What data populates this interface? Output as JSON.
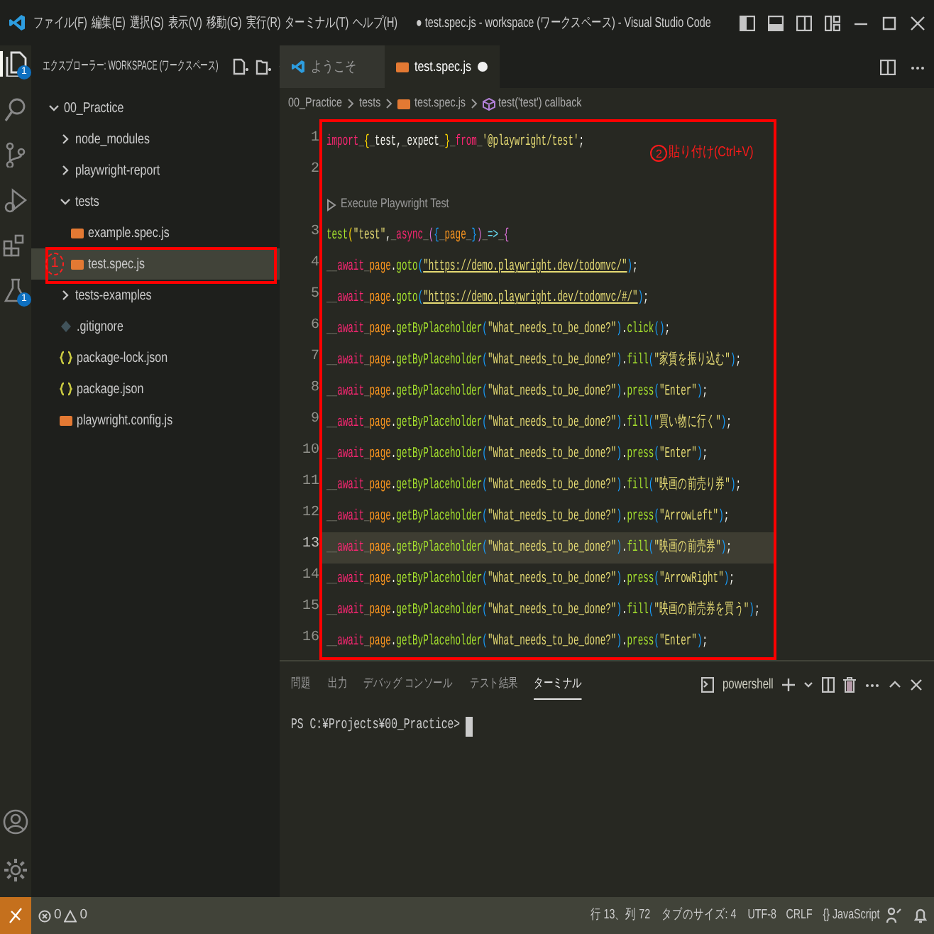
{
  "title_bar": {
    "menus": [
      "ファイル(F)",
      "編集(E)",
      "選択(S)",
      "表示(V)",
      "移動(G)",
      "実行(R)",
      "ターミナル(T)",
      "ヘルプ(H)"
    ],
    "title": "● test.spec.js - workspace (ワークスペース) - Visual Studio Code"
  },
  "activity_bar": {
    "items": [
      {
        "kind": "explorer",
        "selected": true,
        "badge": "1"
      },
      {
        "kind": "search",
        "selected": false
      },
      {
        "kind": "source-control",
        "selected": false
      },
      {
        "kind": "run-debug",
        "selected": false
      },
      {
        "kind": "extensions",
        "selected": false
      },
      {
        "kind": "testing",
        "selected": false,
        "badge": "1"
      }
    ],
    "bottom": [
      {
        "kind": "account"
      },
      {
        "kind": "settings"
      }
    ]
  },
  "sidebar": {
    "title": "エクスプローラー: WORKSPACE (ワークスペース)",
    "tree": [
      {
        "label": "00_Practice",
        "kind": "folder",
        "expanded": true,
        "selected": false,
        "children": [
          {
            "label": "node_modules",
            "kind": "folder",
            "expanded": false,
            "selected": false
          },
          {
            "label": "playwright-report",
            "kind": "folder",
            "expanded": false,
            "selected": false
          },
          {
            "label": "tests",
            "kind": "folder",
            "expanded": true,
            "selected": false,
            "children": [
              {
                "label": "example.spec.js",
                "kind": "js",
                "selected": false
              },
              {
                "label": "test.spec.js",
                "kind": "js",
                "selected": true,
                "callout": "1"
              }
            ]
          },
          {
            "label": "tests-examples",
            "kind": "folder",
            "expanded": false,
            "selected": false
          },
          {
            "label": ".gitignore",
            "kind": "gitignore",
            "selected": false
          },
          {
            "label": "package-lock.json",
            "kind": "json",
            "selected": false
          },
          {
            "label": "package.json",
            "kind": "json",
            "selected": false
          },
          {
            "label": "playwright.config.js",
            "kind": "js",
            "selected": false
          }
        ]
      }
    ]
  },
  "editor": {
    "tabs": [
      {
        "label": "ようこそ",
        "kind": "welcome",
        "selected": false,
        "modified": false
      },
      {
        "label": "test.spec.js",
        "kind": "js",
        "selected": true,
        "modified": true
      }
    ],
    "breadcrumb": [
      {
        "label": "00_Practice",
        "kind": "folder"
      },
      {
        "label": "tests",
        "kind": "folder"
      },
      {
        "label": "test.spec.js",
        "kind": "js"
      },
      {
        "label": "test('test') callback",
        "kind": "symbol"
      }
    ],
    "callout": {
      "marker": "2",
      "text": "貼り付け(Ctrl+V)"
    },
    "lines": [
      {
        "kind": "code",
        "number": "1",
        "current": false,
        "tokens": [
          {
            "kind": "keyword",
            "text": "import"
          },
          {
            "kind": "space",
            "text": "_"
          },
          {
            "kind": "bracket1",
            "text": "{"
          },
          {
            "kind": "space",
            "text": "_"
          },
          {
            "kind": "name",
            "text": "test"
          },
          {
            "kind": "punct",
            "text": ","
          },
          {
            "kind": "space",
            "text": "_"
          },
          {
            "kind": "name",
            "text": "expect"
          },
          {
            "kind": "space",
            "text": "_"
          },
          {
            "kind": "bracket1",
            "text": "}"
          },
          {
            "kind": "space",
            "text": "_"
          },
          {
            "kind": "keyword",
            "text": "from"
          },
          {
            "kind": "space",
            "text": "_"
          },
          {
            "kind": "string",
            "text": "'@playwright/test'"
          },
          {
            "kind": "punct",
            "text": ";"
          }
        ]
      },
      {
        "kind": "code",
        "number": "2",
        "current": false
      },
      {
        "kind": "codelens",
        "text": "Execute Playwright Test"
      },
      {
        "kind": "code",
        "number": "3",
        "current": false,
        "tokens": [
          {
            "kind": "function",
            "text": "test"
          },
          {
            "kind": "bracket1",
            "text": "("
          },
          {
            "kind": "string",
            "text": "\"test\""
          },
          {
            "kind": "punct",
            "text": ","
          },
          {
            "kind": "space",
            "text": "_"
          },
          {
            "kind": "keyword",
            "text": "async"
          },
          {
            "kind": "space",
            "text": "_"
          },
          {
            "kind": "bracket2",
            "text": "("
          },
          {
            "kind": "bracket3",
            "text": "{"
          },
          {
            "kind": "space",
            "text": "_"
          },
          {
            "kind": "param",
            "text": "page"
          },
          {
            "kind": "space",
            "text": "_"
          },
          {
            "kind": "bracket3",
            "text": "}"
          },
          {
            "kind": "bracket2",
            "text": ")"
          },
          {
            "kind": "space",
            "text": "_"
          },
          {
            "kind": "arrow",
            "text": "=>"
          },
          {
            "kind": "space",
            "text": "_"
          },
          {
            "kind": "bracket2",
            "text": "{"
          }
        ]
      },
      {
        "kind": "code",
        "number": "4",
        "current": false,
        "tokens": [
          {
            "kind": "space",
            "text": "__"
          },
          {
            "kind": "keyword",
            "text": "await"
          },
          {
            "kind": "space",
            "text": "_"
          },
          {
            "kind": "param",
            "text": "page"
          },
          {
            "kind": "punct",
            "text": "."
          },
          {
            "kind": "function",
            "text": "goto"
          },
          {
            "kind": "bracket3",
            "text": "("
          },
          {
            "kind": "link",
            "text": "\"https://demo.playwright.dev/todomvc/\""
          },
          {
            "kind": "bracket3",
            "text": ")"
          },
          {
            "kind": "punct",
            "text": ";"
          }
        ]
      },
      {
        "kind": "code",
        "number": "5",
        "current": false,
        "tokens": [
          {
            "kind": "space",
            "text": "__"
          },
          {
            "kind": "keyword",
            "text": "await"
          },
          {
            "kind": "space",
            "text": "_"
          },
          {
            "kind": "param",
            "text": "page"
          },
          {
            "kind": "punct",
            "text": "."
          },
          {
            "kind": "function",
            "text": "goto"
          },
          {
            "kind": "bracket3",
            "text": "("
          },
          {
            "kind": "link",
            "text": "\"https://demo.playwright.dev/todomvc/#/\""
          },
          {
            "kind": "bracket3",
            "text": ")"
          },
          {
            "kind": "punct",
            "text": ";"
          }
        ]
      },
      {
        "kind": "code",
        "number": "6",
        "current": false,
        "tokens": [
          {
            "kind": "space",
            "text": "__"
          },
          {
            "kind": "keyword",
            "text": "await"
          },
          {
            "kind": "space",
            "text": "_"
          },
          {
            "kind": "param",
            "text": "page"
          },
          {
            "kind": "punct",
            "text": "."
          },
          {
            "kind": "function",
            "text": "getByPlaceholder"
          },
          {
            "kind": "bracket3",
            "text": "("
          },
          {
            "kind": "string",
            "text": "\"What_needs_to_be_done?\""
          },
          {
            "kind": "bracket3",
            "text": ")"
          },
          {
            "kind": "punct",
            "text": "."
          },
          {
            "kind": "function",
            "text": "click"
          },
          {
            "kind": "bracket3",
            "text": "()"
          },
          {
            "kind": "punct",
            "text": ";"
          }
        ]
      },
      {
        "kind": "code",
        "number": "7",
        "current": false,
        "tokens": [
          {
            "kind": "space",
            "text": "__"
          },
          {
            "kind": "keyword",
            "text": "await"
          },
          {
            "kind": "space",
            "text": "_"
          },
          {
            "kind": "param",
            "text": "page"
          },
          {
            "kind": "punct",
            "text": "."
          },
          {
            "kind": "function",
            "text": "getByPlaceholder"
          },
          {
            "kind": "bracket3",
            "text": "("
          },
          {
            "kind": "string",
            "text": "\"What_needs_to_be_done?\""
          },
          {
            "kind": "bracket3",
            "text": ")"
          },
          {
            "kind": "punct",
            "text": "."
          },
          {
            "kind": "function",
            "text": "fill"
          },
          {
            "kind": "bracket3",
            "text": "("
          },
          {
            "kind": "string",
            "text": "\"家賃を振り込む\""
          },
          {
            "kind": "bracket3",
            "text": ")"
          },
          {
            "kind": "punct",
            "text": ";"
          }
        ]
      },
      {
        "kind": "code",
        "number": "8",
        "current": false,
        "tokens": [
          {
            "kind": "space",
            "text": "__"
          },
          {
            "kind": "keyword",
            "text": "await"
          },
          {
            "kind": "space",
            "text": "_"
          },
          {
            "kind": "param",
            "text": "page"
          },
          {
            "kind": "punct",
            "text": "."
          },
          {
            "kind": "function",
            "text": "getByPlaceholder"
          },
          {
            "kind": "bracket3",
            "text": "("
          },
          {
            "kind": "string",
            "text": "\"What_needs_to_be_done?\""
          },
          {
            "kind": "bracket3",
            "text": ")"
          },
          {
            "kind": "punct",
            "text": "."
          },
          {
            "kind": "function",
            "text": "press"
          },
          {
            "kind": "bracket3",
            "text": "("
          },
          {
            "kind": "string",
            "text": "\"Enter\""
          },
          {
            "kind": "bracket3",
            "text": ")"
          },
          {
            "kind": "punct",
            "text": ";"
          }
        ]
      },
      {
        "kind": "code",
        "number": "9",
        "current": false,
        "tokens": [
          {
            "kind": "space",
            "text": "__"
          },
          {
            "kind": "keyword",
            "text": "await"
          },
          {
            "kind": "space",
            "text": "_"
          },
          {
            "kind": "param",
            "text": "page"
          },
          {
            "kind": "punct",
            "text": "."
          },
          {
            "kind": "function",
            "text": "getByPlaceholder"
          },
          {
            "kind": "bracket3",
            "text": "("
          },
          {
            "kind": "string",
            "text": "\"What_needs_to_be_done?\""
          },
          {
            "kind": "bracket3",
            "text": ")"
          },
          {
            "kind": "punct",
            "text": "."
          },
          {
            "kind": "function",
            "text": "fill"
          },
          {
            "kind": "bracket3",
            "text": "("
          },
          {
            "kind": "string",
            "text": "\"買い物に行く\""
          },
          {
            "kind": "bracket3",
            "text": ")"
          },
          {
            "kind": "punct",
            "text": ";"
          }
        ]
      },
      {
        "kind": "code",
        "number": "10",
        "current": false,
        "tokens": [
          {
            "kind": "space",
            "text": "__"
          },
          {
            "kind": "keyword",
            "text": "await"
          },
          {
            "kind": "space",
            "text": "_"
          },
          {
            "kind": "param",
            "text": "page"
          },
          {
            "kind": "punct",
            "text": "."
          },
          {
            "kind": "function",
            "text": "getByPlaceholder"
          },
          {
            "kind": "bracket3",
            "text": "("
          },
          {
            "kind": "string",
            "text": "\"What_needs_to_be_done?\""
          },
          {
            "kind": "bracket3",
            "text": ")"
          },
          {
            "kind": "punct",
            "text": "."
          },
          {
            "kind": "function",
            "text": "press"
          },
          {
            "kind": "bracket3",
            "text": "("
          },
          {
            "kind": "string",
            "text": "\"Enter\""
          },
          {
            "kind": "bracket3",
            "text": ")"
          },
          {
            "kind": "punct",
            "text": ";"
          }
        ]
      },
      {
        "kind": "code",
        "number": "11",
        "current": false,
        "tokens": [
          {
            "kind": "space",
            "text": "__"
          },
          {
            "kind": "keyword",
            "text": "await"
          },
          {
            "kind": "space",
            "text": "_"
          },
          {
            "kind": "param",
            "text": "page"
          },
          {
            "kind": "punct",
            "text": "."
          },
          {
            "kind": "function",
            "text": "getByPlaceholder"
          },
          {
            "kind": "bracket3",
            "text": "("
          },
          {
            "kind": "string",
            "text": "\"What_needs_to_be_done?\""
          },
          {
            "kind": "bracket3",
            "text": ")"
          },
          {
            "kind": "punct",
            "text": "."
          },
          {
            "kind": "function",
            "text": "fill"
          },
          {
            "kind": "bracket3",
            "text": "("
          },
          {
            "kind": "string",
            "text": "\"映画の前売り券\""
          },
          {
            "kind": "bracket3",
            "text": ")"
          },
          {
            "kind": "punct",
            "text": ";"
          }
        ]
      },
      {
        "kind": "code",
        "number": "12",
        "current": false,
        "tokens": [
          {
            "kind": "space",
            "text": "__"
          },
          {
            "kind": "keyword",
            "text": "await"
          },
          {
            "kind": "space",
            "text": "_"
          },
          {
            "kind": "param",
            "text": "page"
          },
          {
            "kind": "punct",
            "text": "."
          },
          {
            "kind": "function",
            "text": "getByPlaceholder"
          },
          {
            "kind": "bracket3",
            "text": "("
          },
          {
            "kind": "string",
            "text": "\"What_needs_to_be_done?\""
          },
          {
            "kind": "bracket3",
            "text": ")"
          },
          {
            "kind": "punct",
            "text": "."
          },
          {
            "kind": "function",
            "text": "press"
          },
          {
            "kind": "bracket3",
            "text": "("
          },
          {
            "kind": "string",
            "text": "\"ArrowLeft\""
          },
          {
            "kind": "bracket3",
            "text": ")"
          },
          {
            "kind": "punct",
            "text": ";"
          }
        ]
      },
      {
        "kind": "code",
        "number": "13",
        "current": true,
        "tokens": [
          {
            "kind": "space",
            "text": "__"
          },
          {
            "kind": "keyword",
            "text": "await"
          },
          {
            "kind": "space",
            "text": "_"
          },
          {
            "kind": "param",
            "text": "page"
          },
          {
            "kind": "punct",
            "text": "."
          },
          {
            "kind": "function",
            "text": "getByPlaceholder"
          },
          {
            "kind": "bracket3",
            "text": "("
          },
          {
            "kind": "string",
            "text": "\"What_needs_to_be_done?\""
          },
          {
            "kind": "bracket3",
            "text": ")"
          },
          {
            "kind": "punct",
            "text": "."
          },
          {
            "kind": "function",
            "text": "fill"
          },
          {
            "kind": "bracket3",
            "text": "("
          },
          {
            "kind": "string",
            "text": "\"映画の前売券\""
          },
          {
            "kind": "bracket3",
            "text": ")"
          },
          {
            "kind": "punct",
            "text": ";"
          }
        ]
      },
      {
        "kind": "code",
        "number": "14",
        "current": false,
        "tokens": [
          {
            "kind": "space",
            "text": "__"
          },
          {
            "kind": "keyword",
            "text": "await"
          },
          {
            "kind": "space",
            "text": "_"
          },
          {
            "kind": "param",
            "text": "page"
          },
          {
            "kind": "punct",
            "text": "."
          },
          {
            "kind": "function",
            "text": "getByPlaceholder"
          },
          {
            "kind": "bracket3",
            "text": "("
          },
          {
            "kind": "string",
            "text": "\"What_needs_to_be_done?\""
          },
          {
            "kind": "bracket3",
            "text": ")"
          },
          {
            "kind": "punct",
            "text": "."
          },
          {
            "kind": "function",
            "text": "press"
          },
          {
            "kind": "bracket3",
            "text": "("
          },
          {
            "kind": "string",
            "text": "\"ArrowRight\""
          },
          {
            "kind": "bracket3",
            "text": ")"
          },
          {
            "kind": "punct",
            "text": ";"
          }
        ]
      },
      {
        "kind": "code",
        "number": "15",
        "current": false,
        "tokens": [
          {
            "kind": "space",
            "text": "__"
          },
          {
            "kind": "keyword",
            "text": "await"
          },
          {
            "kind": "space",
            "text": "_"
          },
          {
            "kind": "param",
            "text": "page"
          },
          {
            "kind": "punct",
            "text": "."
          },
          {
            "kind": "function",
            "text": "getByPlaceholder"
          },
          {
            "kind": "bracket3",
            "text": "("
          },
          {
            "kind": "string",
            "text": "\"What_needs_to_be_done?\""
          },
          {
            "kind": "bracket3",
            "text": ")"
          },
          {
            "kind": "punct",
            "text": "."
          },
          {
            "kind": "function",
            "text": "fill"
          },
          {
            "kind": "bracket3",
            "text": "("
          },
          {
            "kind": "string",
            "text": "\"映画の前売券を買う\""
          },
          {
            "kind": "bracket3",
            "text": ")"
          },
          {
            "kind": "punct",
            "text": ";"
          }
        ]
      },
      {
        "kind": "code",
        "number": "16",
        "current": false,
        "tokens": [
          {
            "kind": "space",
            "text": "__"
          },
          {
            "kind": "keyword",
            "text": "await"
          },
          {
            "kind": "space",
            "text": "_"
          },
          {
            "kind": "param",
            "text": "page"
          },
          {
            "kind": "punct",
            "text": "."
          },
          {
            "kind": "function",
            "text": "getByPlaceholder"
          },
          {
            "kind": "bracket3",
            "text": "("
          },
          {
            "kind": "string",
            "text": "\"What_needs_to_be_done?\""
          },
          {
            "kind": "bracket3",
            "text": ")"
          },
          {
            "kind": "punct",
            "text": "."
          },
          {
            "kind": "function",
            "text": "press"
          },
          {
            "kind": "bracket3",
            "text": "("
          },
          {
            "kind": "string",
            "text": "\"Enter\""
          },
          {
            "kind": "bracket3",
            "text": ")"
          },
          {
            "kind": "punct",
            "text": ";"
          }
        ]
      }
    ]
  },
  "panel": {
    "tabs": [
      {
        "label": "問題",
        "selected": false
      },
      {
        "label": "出力",
        "selected": false
      },
      {
        "label": "デバッグ コンソール",
        "selected": false
      },
      {
        "label": "テスト結果",
        "selected": false
      },
      {
        "label": "ターミナル",
        "selected": true
      }
    ],
    "shell": "powershell",
    "prompt": "PS C:¥Projects¥00_Practice>"
  },
  "status_bar": {
    "errors": "0",
    "warnings": "0",
    "items": [
      "行 13、列 72",
      "タブのサイズ: 4",
      "UTF-8",
      "CRLF",
      "{} JavaScript"
    ]
  }
}
